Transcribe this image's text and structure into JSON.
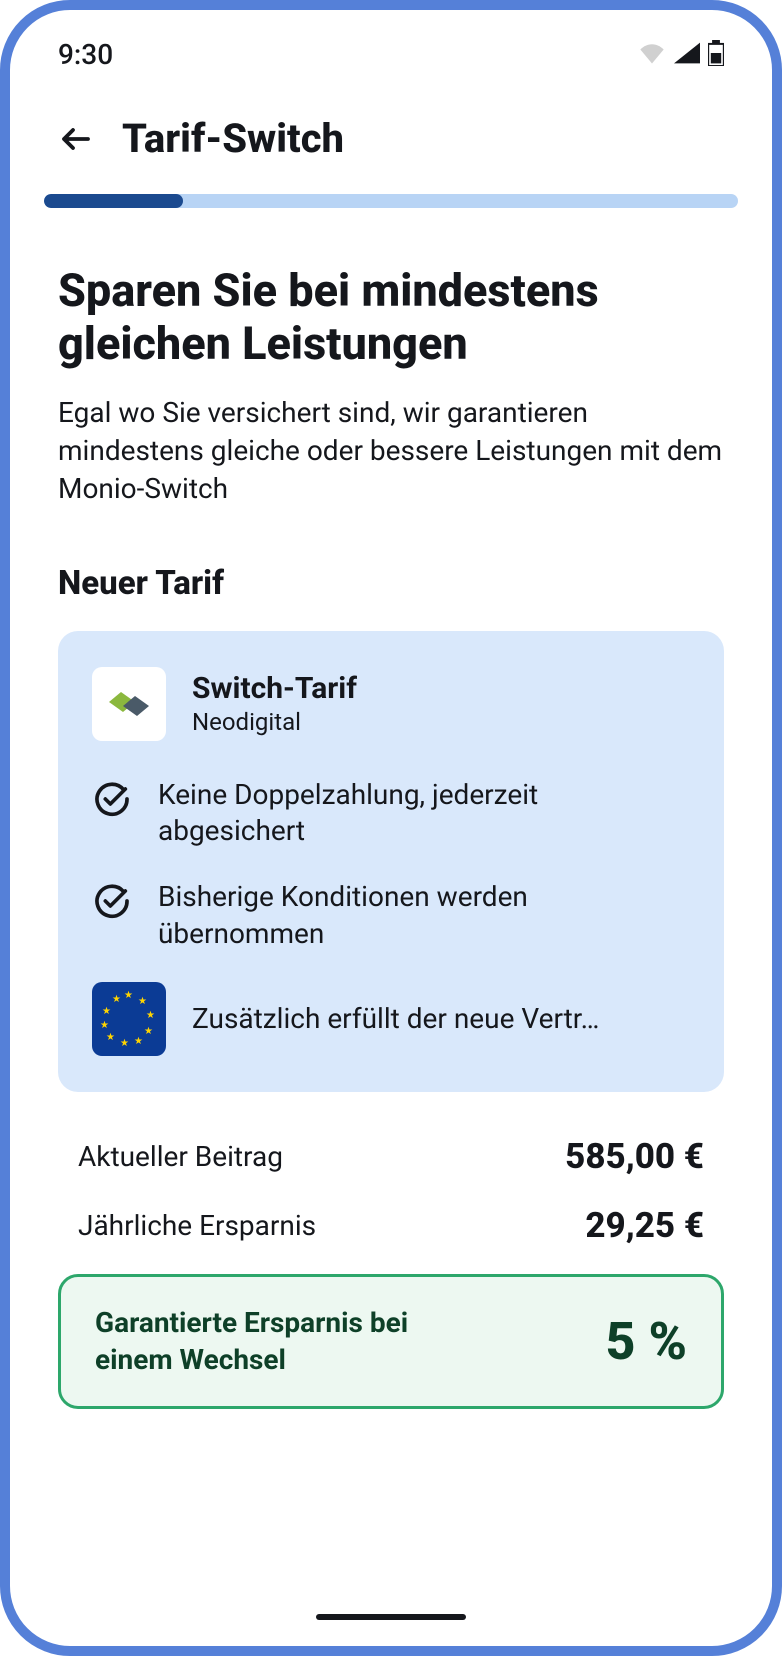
{
  "status": {
    "time": "9:30"
  },
  "header": {
    "title": "Tarif-Switch"
  },
  "hero": {
    "headline": "Sparen Sie bei mindestens gleichen Leistungen",
    "subtext": "Egal wo Sie versichert sind, wir garantieren mindestens gleiche oder bessere Leistungen mit dem Monio-Switch"
  },
  "tariff": {
    "section_title": "Neuer Tarif",
    "name": "Switch-Tarif",
    "provider": "Neodigital",
    "benefits": [
      "Keine Doppelzahlung, jederzeit abgesichert",
      "Bisherige Konditionen werden übernommen",
      "Zusätzlich erfüllt der neue Vertr…"
    ]
  },
  "costs": {
    "current_label": "Aktueller Beitrag",
    "current_value": "585,00 €",
    "yearly_label": "Jährliche Ersparnis",
    "yearly_value": "29,25 €"
  },
  "savings": {
    "label": "Garantierte Ersparnis bei einem Wechsel",
    "value": "5 %"
  }
}
